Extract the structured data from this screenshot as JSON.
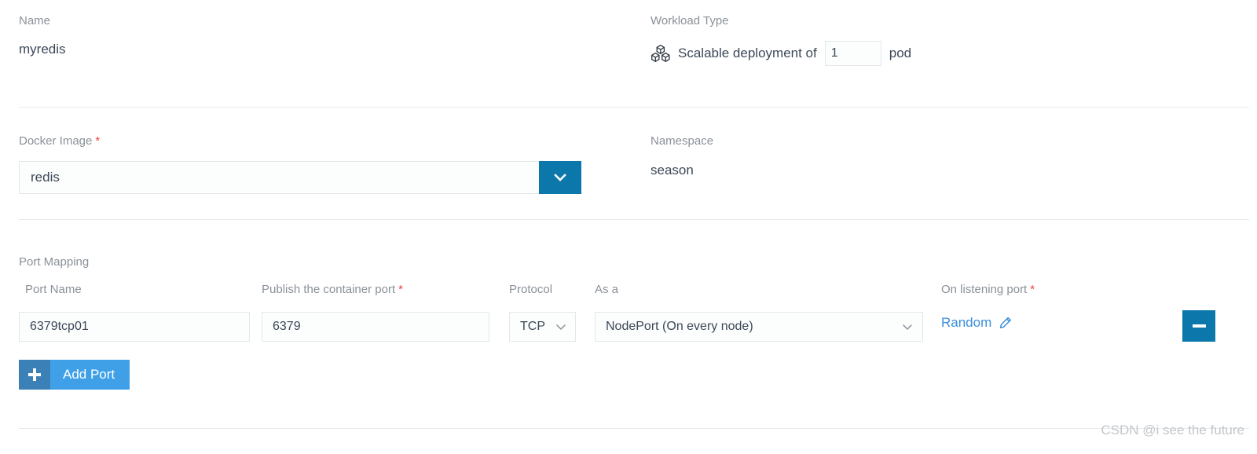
{
  "colors": {
    "accent_blue": "#0b77ab",
    "link_blue": "#3b8fdb",
    "add_button_body": "#3fa0e8",
    "add_button_icon": "#3c80b8",
    "required_red": "#e8443a",
    "label_gray": "#8a9199",
    "value_dark": "#3c4858",
    "divider": "#e8eaec"
  },
  "section_name": {
    "label": "Name",
    "value": "myredis"
  },
  "section_workload": {
    "label": "Workload Type",
    "icon": "deployment-cubes-icon",
    "text_before": "Scalable deployment of",
    "replica_count": "1",
    "text_after": "pod"
  },
  "section_image": {
    "label": "Docker Image",
    "required_marker": "*",
    "value": "redis",
    "placeholder": "",
    "dropdown_icon": "chevron-down-icon"
  },
  "section_namespace": {
    "label": "Namespace",
    "value": "season"
  },
  "section_port_mapping": {
    "title": "Port Mapping",
    "headers": {
      "port_name": "Port Name",
      "publish_port": "Publish the container port",
      "publish_port_required": "*",
      "protocol": "Protocol",
      "as_a": "As a",
      "listening_port": "On listening port",
      "listening_port_required": "*"
    },
    "rows": [
      {
        "port_name": "6379tcp01",
        "port_name_placeholder": "",
        "publish_port": "6379",
        "publish_port_placeholder": "",
        "protocol": "TCP",
        "as_a": "NodePort (On every node)",
        "listening_port": "Random",
        "listening_port_edit_icon": "pencil-icon",
        "remove_icon": "minus-icon"
      }
    ],
    "add_button": {
      "icon": "plus-icon",
      "label": "Add Port"
    }
  },
  "watermark": {
    "text": "CSDN @i see the future"
  }
}
